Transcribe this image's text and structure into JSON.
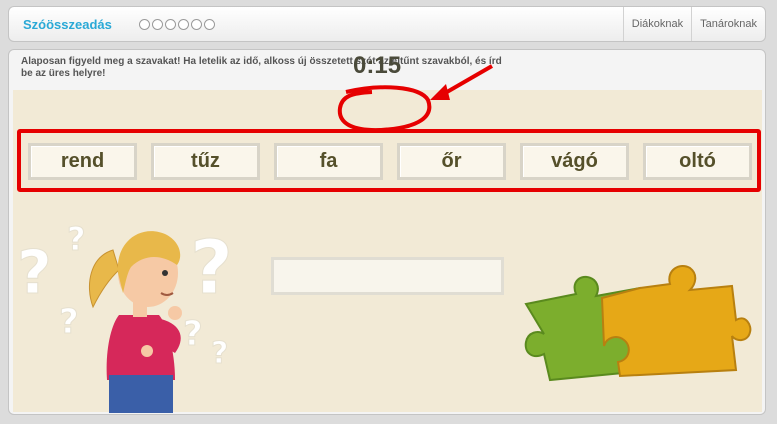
{
  "header": {
    "title": "Szóösszeadás",
    "nav": [
      "Diákoknak",
      "Tanároknak"
    ]
  },
  "progress": {
    "total": 6,
    "completed": 0
  },
  "instruction": "Alaposan figyeld meg a szavakat! Ha letelik az idő, alkoss új összetett szót az eltűnt szavakból, és írd be az üres helyre!",
  "timer": "0:15",
  "words": [
    "rend",
    "tűz",
    "fa",
    "őr",
    "vágó",
    "oltó"
  ],
  "answer": {
    "value": "",
    "placeholder": ""
  },
  "colors": {
    "accent": "#2aa9d6",
    "annotation": "#e60000",
    "stage": "#f2ead6",
    "puzzle_green": "#7cae2d",
    "puzzle_orange": "#e6a817"
  },
  "illustrations": [
    "thinking-girl-illustration",
    "question-mark-icon",
    "puzzle-pieces-icon"
  ]
}
